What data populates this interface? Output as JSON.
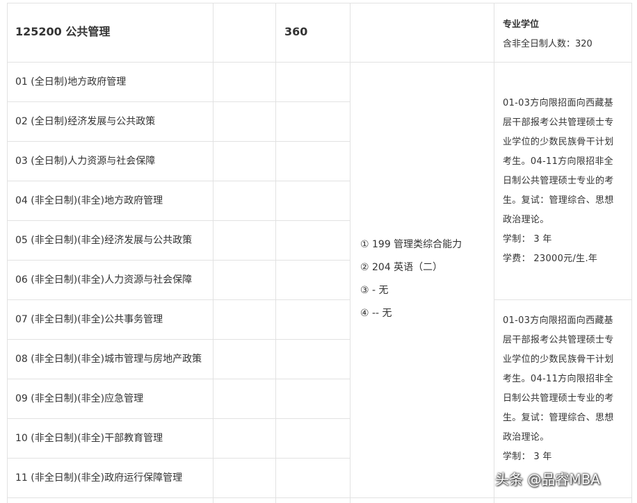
{
  "header_row": {
    "program": "125200 公共管理",
    "enrollment": "360",
    "degree_type": "专业学位",
    "part_time_count": "含非全日制人数：320"
  },
  "directions": [
    "01 (全日制)地方政府管理",
    "02 (全日制)经济发展与公共政策",
    "03 (全日制)人力资源与社会保障",
    "04 (非全日制)(非全)地方政府管理",
    "05 (非全日制)(非全)经济发展与公共政策",
    "06 (非全日制)(非全)人力资源与社会保障",
    "07 (非全日制)(非全)公共事务管理",
    "08 (非全日制)(非全)城市管理与房地产政策",
    "09 (非全日制)(非全)应急管理",
    "10 (非全日制)(非全)干部教育管理",
    "11 (非全日制)(非全)政府运行保障管理"
  ],
  "exam_subjects": [
    "① 199 管理类综合能力",
    "② 204 英语（二）",
    "③ - 无",
    "④ -- 无"
  ],
  "notes": [
    {
      "lines": [
        "01-03方向限招面向西藏基",
        "层干部报考公共管理硕士专",
        "业学位的少数民族骨干计划",
        "考生。04-11方向限招非全",
        "日制公共管理硕士专业的考",
        "生。复试：管理综合、思想",
        "政治理论。",
        "学制： 3 年",
        "学费： 23000元/生.年"
      ]
    },
    {
      "lines": [
        "01-03方向限招面向西藏基",
        "层干部报考公共管理硕士专",
        "业学位的少数民族骨干计划",
        "考生。04-11方向限招非全",
        "日制公共管理硕士专业的考",
        "生。复试：管理综合、思想",
        "政治理论。",
        "学制： 3 年"
      ]
    }
  ],
  "watermark": "头条 @品睿MBA"
}
